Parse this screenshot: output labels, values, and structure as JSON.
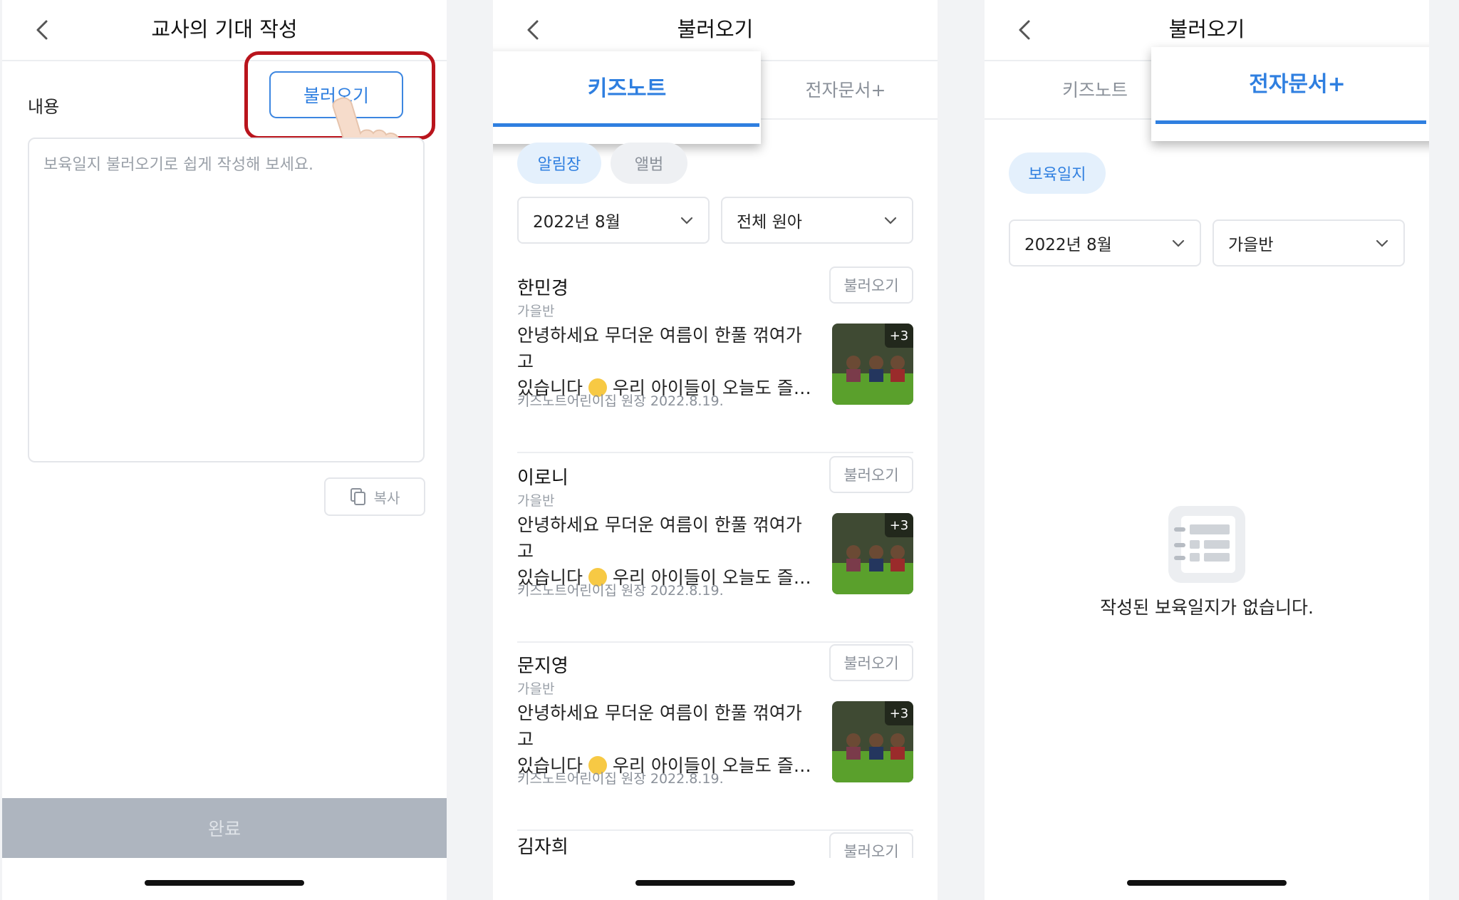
{
  "screen1": {
    "title": "교사의 기대 작성",
    "content_label": "내용",
    "load_button": "불러오기",
    "placeholder": "보육일지 불러오기로 쉽게 작성해 보세요.",
    "copy_button": "복사",
    "done_button": "완료"
  },
  "screen2": {
    "title": "불러오기",
    "tabs": [
      "키즈노트",
      "전자문서+"
    ],
    "active_tab": "키즈노트",
    "chips": [
      "알림장",
      "앨범"
    ],
    "month_select": "2022년 8월",
    "child_select": "전체 원아",
    "items": [
      {
        "name": "한민경",
        "class": "가을반",
        "text1": "안녕하세요 무더운 여름이 한풀 꺾여가고",
        "text2_a": "있습니다",
        "text2_b": "우리 아이들이 오늘도 즐…",
        "meta": "키즈노트어린이집 원장 2022.8.19.",
        "photo_count": "+3",
        "button": "불러오기"
      },
      {
        "name": "이로니",
        "class": "가을반",
        "text1": "안녕하세요 무더운 여름이 한풀 꺾여가고",
        "text2_a": "있습니다",
        "text2_b": "우리 아이들이 오늘도 즐…",
        "meta": "키즈노트어린이집 원장 2022.8.19.",
        "photo_count": "+3",
        "button": "불러오기"
      },
      {
        "name": "문지영",
        "class": "가을반",
        "text1": "안녕하세요 무더운 여름이 한풀 꺾여가고",
        "text2_a": "있습니다",
        "text2_b": "우리 아이들이 오늘도 즐…",
        "meta": "키즈노트어린이집 원장 2022.8.19.",
        "photo_count": "+3",
        "button": "불러오기"
      },
      {
        "name": "김자희",
        "button": "불러오기"
      }
    ]
  },
  "screen3": {
    "title": "불러오기",
    "tabs": [
      "키즈노트",
      "전자문서+"
    ],
    "active_tab": "전자문서+",
    "chip": "보육일지",
    "month_select": "2022년 8월",
    "class_select": "가을반",
    "empty_message": "작성된 보육일지가 없습니다."
  },
  "colors": {
    "accent": "#2f7fe0",
    "highlight": "#b9141c",
    "done_bar": "#aeb5bf"
  }
}
